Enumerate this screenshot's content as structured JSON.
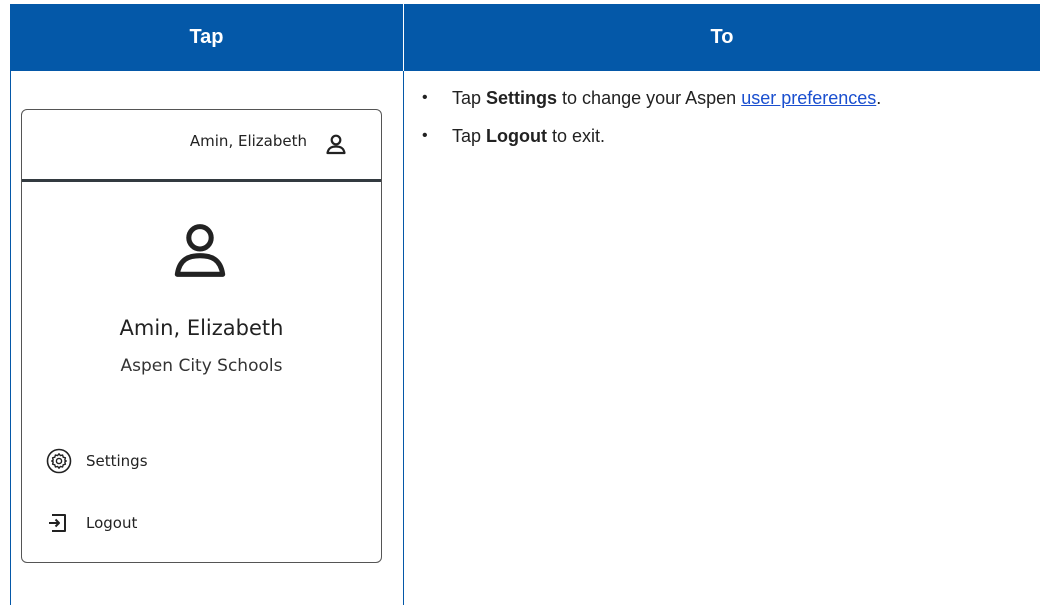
{
  "table": {
    "header_tap": "Tap",
    "header_to": "To"
  },
  "mock": {
    "topbar_name": "Amin, Elizabeth",
    "profile_name": "Amin, Elizabeth",
    "profile_org": "Aspen City Schools",
    "menu": {
      "settings_label": "Settings",
      "logout_label": "Logout"
    },
    "icons": {
      "topbar_user": "user-icon",
      "profile_user": "user-icon",
      "settings": "gear-icon",
      "logout": "logout-icon"
    }
  },
  "instructions": {
    "item1": {
      "bullet": "•",
      "prefix": "Tap ",
      "keyword": "Settings",
      "middle": " to change your Aspen ",
      "link_text": "user preferences",
      "suffix": "."
    },
    "item2": {
      "bullet": "•",
      "prefix": "Tap ",
      "keyword": "Logout",
      "suffix": " to exit."
    }
  },
  "colors": {
    "header_bg": "#0458a8",
    "header_text": "#ffffff",
    "link": "#1a4fcf",
    "mock_divider": "#333a40"
  }
}
